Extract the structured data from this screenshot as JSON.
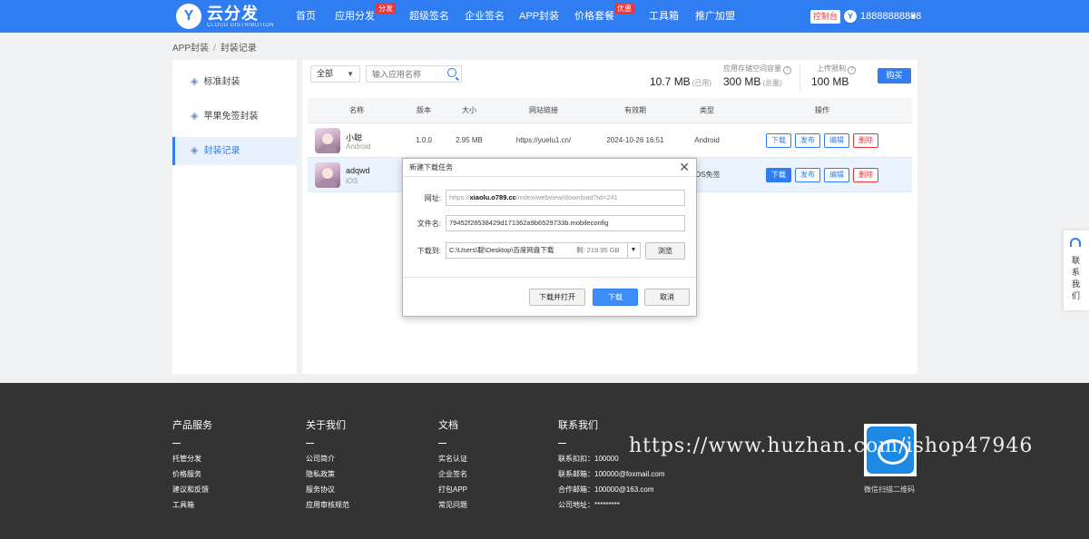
{
  "header": {
    "logo_letter": "Y",
    "logo_name": "云分发",
    "logo_sub": "CLOUD DISTRIBUTION",
    "nav": [
      {
        "label": "首页"
      },
      {
        "label": "应用分发",
        "badge": "分发"
      },
      {
        "label": "超级签名"
      },
      {
        "label": "企业签名"
      },
      {
        "label": "APP封装"
      },
      {
        "label": "价格套餐",
        "badge": "优惠"
      },
      {
        "label": "工具箱"
      },
      {
        "label": "推广加盟"
      }
    ],
    "console_label": "控制台",
    "avatar_letter": "Y",
    "user_phone": "18888888888",
    "caret": "▼"
  },
  "breadcrumb": {
    "root": "APP封装",
    "sep": "/",
    "current": "封装记录"
  },
  "sidebar": {
    "items": [
      {
        "label": "标准封装",
        "icon": "cube-icon"
      },
      {
        "label": "苹果免签封装",
        "icon": "cube-icon"
      },
      {
        "label": "封装记录",
        "icon": "cube-icon",
        "active": true
      }
    ]
  },
  "toolbar": {
    "filter_value": "全部",
    "search_placeholder": "输入应用名称",
    "storage_label": "应用存储空间容量",
    "used_value": "10.7 MB",
    "used_suffix": "(已用)",
    "total_value": "300 MB",
    "total_suffix": "(总量)",
    "upload_label": "上传限制",
    "upload_value": "100 MB",
    "buy_label": "购买",
    "help_glyph": "?"
  },
  "table": {
    "headers": [
      "名称",
      "版本",
      "大小",
      "网站链接",
      "有效期",
      "类型",
      "操作"
    ],
    "rows": [
      {
        "name": "小聪",
        "platform": "Android",
        "version": "1.0.0",
        "size": "2.95 MB",
        "url": "https://yuelu1.cn/",
        "expiry": "2024-10-26 16:51",
        "type": "Android"
      },
      {
        "name": "adqwd",
        "platform": "iOS",
        "version": "",
        "size": "",
        "url": "",
        "expiry": "",
        "type": "iOS免签"
      }
    ],
    "actions": {
      "download": "下载",
      "publish": "发布",
      "edit": "编辑",
      "delete": "删除"
    }
  },
  "dialog": {
    "title": "新建下载任务",
    "close_glyph": "✕",
    "url_label": "网址:",
    "url_prefix": "https://",
    "url_domain": "xiaolu.o789.cc",
    "url_path": "/index/webview/download?id=241",
    "filename_label": "文件名:",
    "filename_value": "79452f28538429d171362a9b6529733b.mobileconfig",
    "saveto_label": "下载到:",
    "saveto_value": "C:\\Users\\聪\\Desktop\\百度网盘下载",
    "free_space": "剩: 219.95 GB",
    "combo_caret": "▼",
    "browse_label": "浏览",
    "open_label": "下载并打开",
    "download_label": "下载",
    "cancel_label": "取消"
  },
  "contact_float": {
    "text": "联系我们"
  },
  "footer": {
    "cols": [
      {
        "title": "产品服务",
        "links": [
          "托管分发",
          "价格服务",
          "建议和反馈",
          "工具箱"
        ]
      },
      {
        "title": "关于我们",
        "links": [
          "公司简介",
          "隐私政策",
          "服务协议",
          "应用审核规范"
        ]
      },
      {
        "title": "文档",
        "links": [
          "实名认证",
          "企业签名",
          "打包APP",
          "常见问题"
        ]
      },
      {
        "title": "联系我们",
        "links": [
          "联系扣扣：100000",
          "联系邮箱：100000@foxmail.com",
          "合作邮箱：100000@163.com",
          "公司地址：*********"
        ]
      }
    ],
    "qr_caption": "微信扫描二维码",
    "watermark": "https://www.huzhan.com/ishop47946"
  }
}
